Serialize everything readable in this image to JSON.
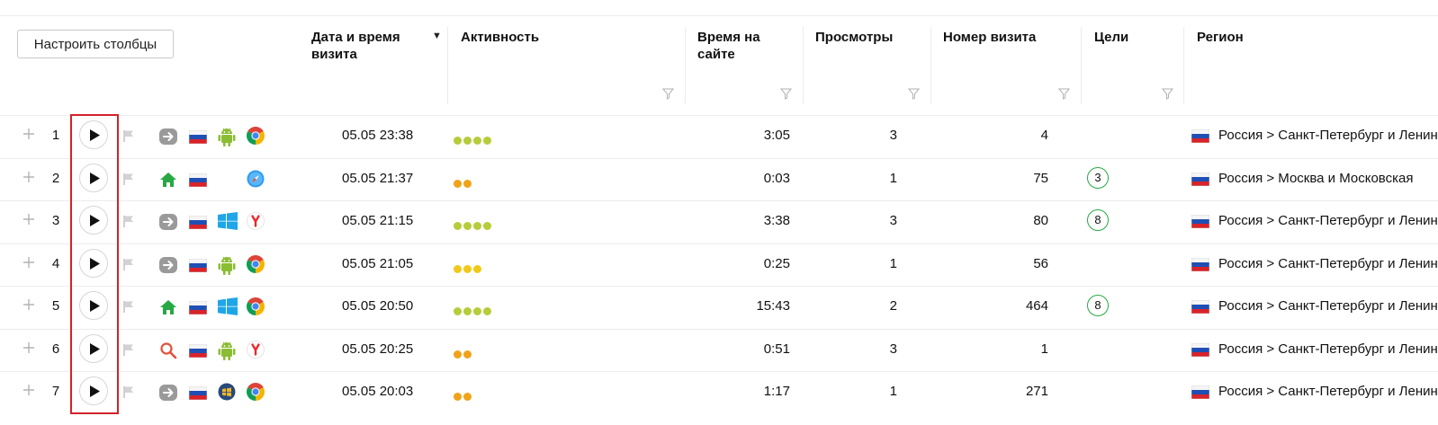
{
  "toolbar": {
    "configure_columns": "Настроить столбцы"
  },
  "columns": {
    "datetime": "Дата и время визита",
    "activity": "Активность",
    "time_on_site": "Время на сайте",
    "views": "Просмотры",
    "visit_number": "Номер визита",
    "goals": "Цели",
    "region": "Регион",
    "sort_indicator": "▼"
  },
  "colors": {
    "activity_high": "#b6cc3a",
    "activity_mid": "#f2c919",
    "activity_low": "#f0a319",
    "goal_border": "#27a844",
    "highlight": "#d1232a"
  },
  "rows": [
    {
      "num": "1",
      "source_icon": "direct-arrow-icon",
      "country_icon": "russia-flag-icon",
      "os_icon": "android-icon",
      "browser_icon": "chrome-icon",
      "datetime": "05.05 23:38",
      "activity_level": 4,
      "activity_color": "#b6cc3a",
      "duration": "3:05",
      "views": "3",
      "visit_number": "4",
      "goals": "",
      "region": "Россия > Санкт-Петербург и Ленинградская"
    },
    {
      "num": "2",
      "source_icon": "home-icon",
      "country_icon": "russia-flag-icon",
      "os_icon": "",
      "browser_icon": "safari-icon",
      "datetime": "05.05 21:37",
      "activity_level": 2,
      "activity_color": "#f0a319",
      "duration": "0:03",
      "views": "1",
      "visit_number": "75",
      "goals": "3",
      "region": "Россия > Москва и Московская"
    },
    {
      "num": "3",
      "source_icon": "direct-arrow-icon",
      "country_icon": "russia-flag-icon",
      "os_icon": "windows-icon",
      "browser_icon": "yandex-browser-icon",
      "datetime": "05.05 21:15",
      "activity_level": 4,
      "activity_color": "#b6cc3a",
      "duration": "3:38",
      "views": "3",
      "visit_number": "80",
      "goals": "8",
      "region": "Россия > Санкт-Петербург и Ленинградская"
    },
    {
      "num": "4",
      "source_icon": "direct-arrow-icon",
      "country_icon": "russia-flag-icon",
      "os_icon": "android-icon",
      "browser_icon": "chrome-icon",
      "datetime": "05.05 21:05",
      "activity_level": 3,
      "activity_color": "#f2c919",
      "duration": "0:25",
      "views": "1",
      "visit_number": "56",
      "goals": "",
      "region": "Россия > Санкт-Петербург и Ленинградская"
    },
    {
      "num": "5",
      "source_icon": "home-icon",
      "country_icon": "russia-flag-icon",
      "os_icon": "windows-icon",
      "browser_icon": "chrome-icon",
      "datetime": "05.05 20:50",
      "activity_level": 4,
      "activity_color": "#b6cc3a",
      "duration": "15:43",
      "views": "2",
      "visit_number": "464",
      "goals": "8",
      "region": "Россия > Санкт-Петербург и Ленинградская"
    },
    {
      "num": "6",
      "source_icon": "search-icon",
      "country_icon": "russia-flag-icon",
      "os_icon": "android-icon",
      "browser_icon": "yandex-browser-icon",
      "datetime": "05.05 20:25",
      "activity_level": 2,
      "activity_color": "#f0a319",
      "duration": "0:51",
      "views": "3",
      "visit_number": "1",
      "goals": "",
      "region": "Россия > Санкт-Петербург и Ленинградская"
    },
    {
      "num": "7",
      "source_icon": "direct-arrow-icon",
      "country_icon": "russia-flag-icon",
      "os_icon": "windows7-icon",
      "browser_icon": "chrome-icon",
      "datetime": "05.05 20:03",
      "activity_level": 2,
      "activity_color": "#f0a319",
      "duration": "1:17",
      "views": "1",
      "visit_number": "271",
      "goals": "",
      "region": "Россия > Санкт-Петербург и Ленинградская"
    }
  ]
}
